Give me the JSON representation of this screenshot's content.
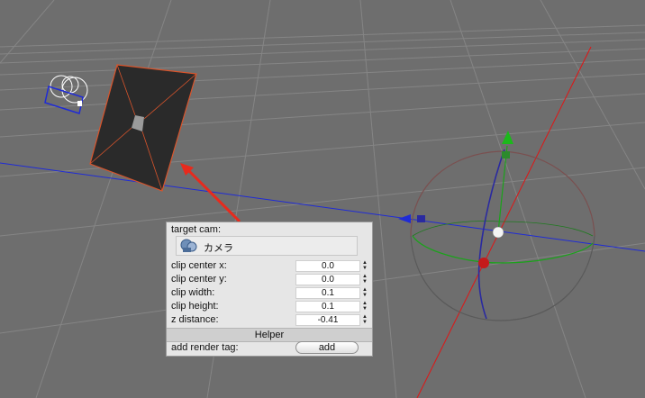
{
  "panel": {
    "target_cam_label": "target cam:",
    "target_cam_value": "カメラ",
    "fields": [
      {
        "label": "clip center x:",
        "value": "0.0"
      },
      {
        "label": "clip center y:",
        "value": "0.0"
      },
      {
        "label": "clip width:",
        "value": "0.1"
      },
      {
        "label": "clip height:",
        "value": "0.1"
      },
      {
        "label": "z distance:",
        "value": "-0.41"
      }
    ],
    "helper_header": "Helper",
    "add_render_tag_label": "add render tag:",
    "add_button": "add"
  },
  "icons": {
    "camera_object": "camera-object-icon",
    "stepper": "stepper-arrows-icon"
  },
  "colors": {
    "viewport_bg": "#6e6e6e",
    "grid_line": "#8a8a8a",
    "blue_axis": "#1f2bd6",
    "red_axis": "#e01515",
    "green_axis": "#1aa31a",
    "plane_fill": "#2a2a2a",
    "plane_outline": "#d9542b"
  }
}
